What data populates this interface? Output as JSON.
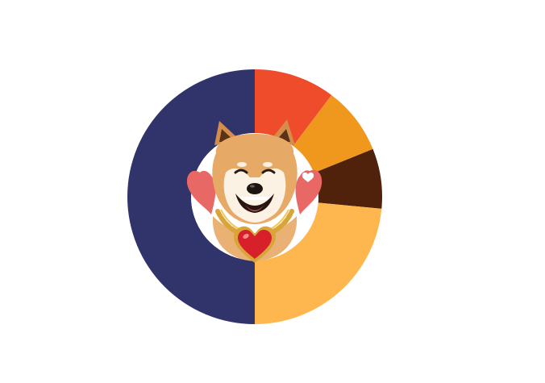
{
  "chart_data": {
    "type": "pie",
    "variant": "donut",
    "title": "",
    "legend": "none",
    "slices": [
      {
        "value": 10.3,
        "color": "#ef4c2c"
      },
      {
        "value": 8.6,
        "color": "#f0981e"
      },
      {
        "value": 7.6,
        "color": "#51220b"
      },
      {
        "value": 23.5,
        "color": "#fdb74e"
      },
      {
        "value": 50.0,
        "color": "#30346b"
      }
    ]
  },
  "center_image": {
    "icon": "shiba-inu-dog-with-heart-pendant-icon"
  }
}
